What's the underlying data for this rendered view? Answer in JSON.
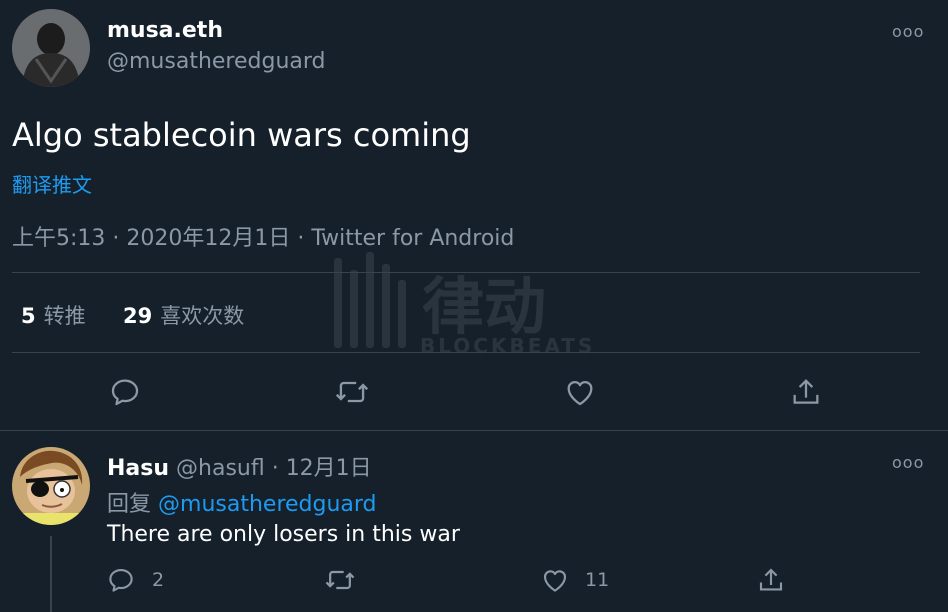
{
  "main_tweet": {
    "display_name": "musa.eth",
    "handle": "@musatheredguard",
    "text": "Algo stablecoin wars coming",
    "translate_label": "翻译推文",
    "timestamp": "上午5:13 · 2020年12月1日 · Twitter for Android",
    "retweets": "5",
    "retweets_label": "转推",
    "likes": "29",
    "likes_label": "喜欢次数",
    "more_label": "ooo"
  },
  "watermark": {
    "chinese": "律动",
    "english": "BLOCKBEATS"
  },
  "reply": {
    "display_name": "Hasu",
    "handle": "@hasufl",
    "date": "· 12月1日",
    "replying_prefix": "回复",
    "replying_to": "@musatheredguard",
    "text": "There are only losers in this war",
    "reply_count": "2",
    "like_count": "11",
    "more_label": "ooo"
  },
  "colors": {
    "background": "#15202b",
    "accent": "#1d9bf0",
    "muted": "#8b98a5",
    "divider": "#38444d"
  },
  "icons": [
    "reply-icon",
    "retweet-icon",
    "like-icon",
    "share-icon",
    "more-icon"
  ]
}
